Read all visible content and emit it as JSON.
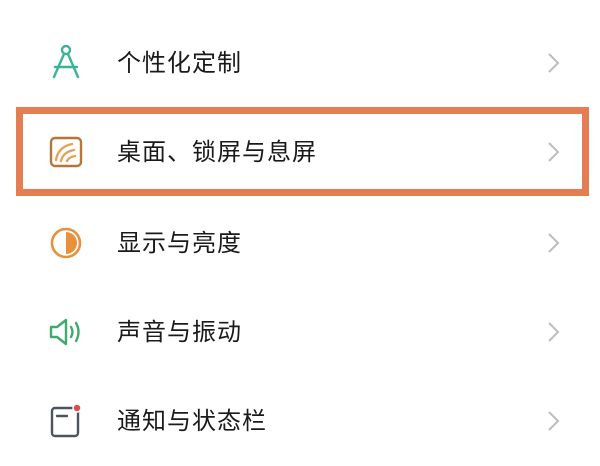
{
  "settings": {
    "items": [
      {
        "label": "个性化定制",
        "icon": "compass-drafting-icon",
        "color": "#3bb39a"
      },
      {
        "label": "桌面、锁屏与息屏",
        "icon": "wallpaper-icon",
        "color": "#b5763a"
      },
      {
        "label": "显示与亮度",
        "icon": "brightness-icon",
        "color": "#e8903a"
      },
      {
        "label": "声音与振动",
        "icon": "speaker-icon",
        "color": "#3faa6b"
      },
      {
        "label": "通知与状态栏",
        "icon": "notification-icon",
        "color": "#4a5560"
      }
    ],
    "chevron_icon": "chevron-right-icon",
    "highlight_color": "#e57d52"
  }
}
